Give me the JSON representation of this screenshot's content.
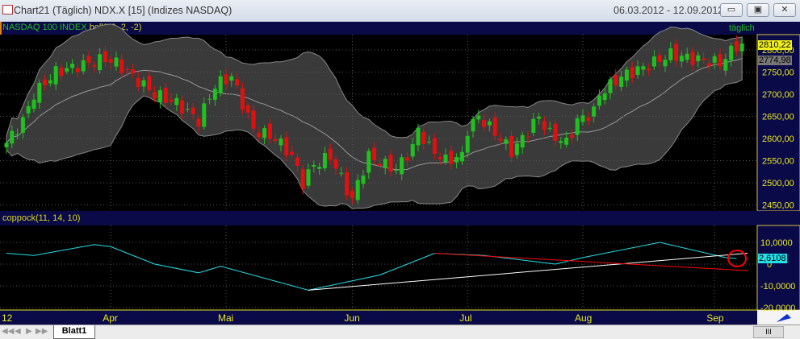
{
  "window": {
    "title": "Chart21 (Täglich)  NDX.X [15] (Indizes NASDAQ)",
    "date_range": "06.03.2012 - 12.09.2012",
    "minimize": "▭",
    "restore": "▣",
    "close": "✕"
  },
  "price_panel": {
    "symbol_label": "NASDAQ 100 INDEX",
    "indicator_label": "boll(20, 2, -2)",
    "period_tag": "täglich",
    "last_price": "2810,22",
    "band_value": "2774,98"
  },
  "coppock_panel": {
    "label": "coppock(11, 14, 10)",
    "last_value": "2,6108"
  },
  "tabs": {
    "sheet": "Blatt1",
    "nav": [
      "◀◀",
      "◀",
      "▶",
      "▶▶"
    ],
    "scroll": "III"
  },
  "colors": {
    "up": "#20c020",
    "down": "#e01010",
    "band": "#444444",
    "coppock": "#20e0e8",
    "axis_text": "#e8e820"
  },
  "chart_data": [
    {
      "type": "candlestick",
      "title": "NASDAQ 100 INDEX",
      "ylim": [
        2430,
        2830
      ],
      "yticks": [
        "2800,00",
        "2750,00",
        "2700,00",
        "2650,00",
        "2600,00",
        "2550,00",
        "2500,00",
        "2450,00"
      ],
      "ytick_values": [
        2800,
        2750,
        2700,
        2650,
        2600,
        2550,
        2500,
        2450
      ],
      "xticks": [
        "12",
        "Apr",
        "Mai",
        "Jun",
        "Jul",
        "Aug",
        "Sep"
      ],
      "xtick_day_index": [
        -1,
        19,
        40,
        63,
        84,
        105,
        129
      ],
      "close_keypoints": [
        [
          0,
          2590
        ],
        [
          3,
          2640
        ],
        [
          5,
          2700
        ],
        [
          9,
          2750
        ],
        [
          15,
          2770
        ],
        [
          18,
          2780
        ],
        [
          20,
          2770
        ],
        [
          27,
          2700
        ],
        [
          31,
          2680
        ],
        [
          35,
          2640
        ],
        [
          38,
          2720
        ],
        [
          41,
          2740
        ],
        [
          43,
          2680
        ],
        [
          45,
          2620
        ],
        [
          49,
          2600
        ],
        [
          52,
          2560
        ],
        [
          54,
          2500
        ],
        [
          56,
          2540
        ],
        [
          59,
          2560
        ],
        [
          61,
          2510
        ],
        [
          63,
          2460
        ],
        [
          64,
          2500
        ],
        [
          66,
          2560
        ],
        [
          69,
          2540
        ],
        [
          71,
          2530
        ],
        [
          74,
          2580
        ],
        [
          75,
          2620
        ],
        [
          77,
          2580
        ],
        [
          80,
          2550
        ],
        [
          83,
          2560
        ],
        [
          84,
          2620
        ],
        [
          86,
          2650
        ],
        [
          90,
          2600
        ],
        [
          92,
          2570
        ],
        [
          94,
          2600
        ],
        [
          97,
          2650
        ],
        [
          99,
          2610
        ],
        [
          102,
          2590
        ],
        [
          104,
          2640
        ],
        [
          107,
          2660
        ],
        [
          108,
          2700
        ],
        [
          112,
          2740
        ],
        [
          116,
          2760
        ],
        [
          121,
          2790
        ],
        [
          125,
          2780
        ],
        [
          130,
          2770
        ],
        [
          133,
          2810
        ],
        [
          134,
          2810
        ]
      ]
    },
    {
      "type": "line",
      "title": "coppock(11, 14, 10)",
      "ylim": [
        -22,
        15
      ],
      "yticks": [
        "10,0000",
        "0",
        "-10,0000",
        "-20,0000"
      ],
      "ytick_values": [
        10,
        0,
        -10,
        -20
      ],
      "series": [
        {
          "name": "coppock",
          "points": [
            [
              0,
              5
            ],
            [
              5,
              4
            ],
            [
              16,
              9
            ],
            [
              19,
              8
            ],
            [
              27,
              0
            ],
            [
              35,
              -4
            ],
            [
              39,
              -1
            ],
            [
              55,
              -12
            ],
            [
              68,
              -5
            ],
            [
              78,
              5
            ],
            [
              87,
              4
            ],
            [
              100,
              0
            ],
            [
              105,
              3
            ],
            [
              119,
              10
            ],
            [
              131,
              3
            ],
            [
              133,
              2.6
            ]
          ]
        }
      ],
      "trendlines": [
        {
          "color": "white",
          "from": [
            55,
            -12
          ],
          "to": [
            135,
            5
          ]
        },
        {
          "color": "red",
          "from": [
            78,
            5
          ],
          "to": [
            135,
            -3
          ]
        }
      ]
    }
  ]
}
